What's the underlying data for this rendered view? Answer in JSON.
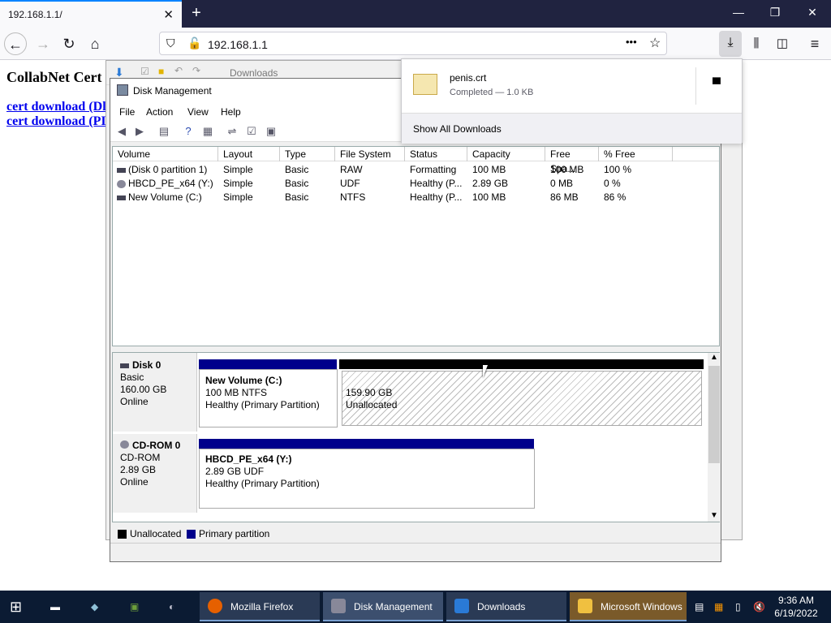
{
  "browser": {
    "tab_title": "192.168.1.1/",
    "tab_close": "✕",
    "new_tab": "+",
    "url": "192.168.1.1",
    "more": "•••"
  },
  "page": {
    "heading": "CollabNet Cert",
    "link1": "cert download (Dl",
    "link2": "cert download (PI"
  },
  "downloads_window_title": "Downloads",
  "disk_mgmt": {
    "title": "Disk Management",
    "menu": [
      "File",
      "Action",
      "View",
      "Help"
    ],
    "columns": [
      "Volume",
      "Layout",
      "Type",
      "File System",
      "Status",
      "Capacity",
      "Free Spa...",
      "% Free"
    ],
    "rows": [
      [
        "(Disk 0 partition 1)",
        "Simple",
        "Basic",
        "RAW",
        "Formatting",
        "100 MB",
        "100 MB",
        "100 %"
      ],
      [
        "HBCD_PE_x64 (Y:)",
        "Simple",
        "Basic",
        "UDF",
        "Healthy (P...",
        "2.89 GB",
        "0 MB",
        "0 %"
      ],
      [
        "New Volume (C:)",
        "Simple",
        "Basic",
        "NTFS",
        "Healthy (P...",
        "100 MB",
        "86 MB",
        "86 %"
      ]
    ],
    "disks": [
      {
        "name": "Disk 0",
        "type": "Basic",
        "size": "160.00 GB",
        "state": "Online",
        "partitions": [
          {
            "name": "New Volume  (C:)",
            "detail": "100 MB NTFS",
            "status": "Healthy (Primary Partition)"
          },
          {
            "name": "",
            "detail": "159.90 GB",
            "status": "Unallocated"
          }
        ]
      },
      {
        "name": "CD-ROM 0",
        "type": "CD-ROM",
        "size": "2.89 GB",
        "state": "Online",
        "partitions": [
          {
            "name": "HBCD_PE_x64  (Y:)",
            "detail": "2.89 GB UDF",
            "status": "Healthy (Primary Partition)"
          }
        ]
      }
    ],
    "legend": [
      "Unallocated",
      "Primary partition"
    ],
    "colors": {
      "primary": "#00008b",
      "unallocated": "#000000"
    }
  },
  "download_panel": {
    "filename": "penis.crt",
    "status": "Completed — 1.0 KB",
    "show_all": "Show All Downloads"
  },
  "taskbar": {
    "items": [
      "Mozilla Firefox",
      "Disk Management",
      "Downloads",
      "Microsoft Windows"
    ],
    "time": "9:36 AM",
    "date": "6/19/2022"
  }
}
